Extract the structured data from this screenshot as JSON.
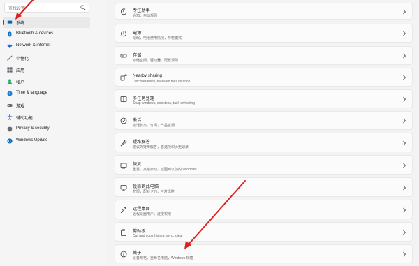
{
  "sidebar": {
    "search_placeholder": "查找设置",
    "items": [
      {
        "label": "系统",
        "icon": "laptop-icon",
        "color": "#0067c0"
      },
      {
        "label": "Bluetooth & devices",
        "icon": "bluetooth-icon",
        "color": "#0067c0"
      },
      {
        "label": "Network & internet",
        "icon": "wifi-icon",
        "color": "#2a6ec6"
      },
      {
        "label": "个性化",
        "icon": "brush-icon",
        "color": "#b56c2c"
      },
      {
        "label": "应用",
        "icon": "apps-icon",
        "color": "#5d6670"
      },
      {
        "label": "帐户",
        "icon": "account-icon",
        "color": "#2fa56f"
      },
      {
        "label": "Time & language",
        "icon": "globe-clock-icon",
        "color": "#1f7fd1"
      },
      {
        "label": "游戏",
        "icon": "gamepad-icon",
        "color": "#6b6b6b"
      },
      {
        "label": "辅助功能",
        "icon": "accessibility-icon",
        "color": "#2b66c4"
      },
      {
        "label": "Privacy & security",
        "icon": "shield-icon",
        "color": "#6b6b6b"
      },
      {
        "label": "Windows Update",
        "icon": "update-icon",
        "color": "#0067c0"
      }
    ]
  },
  "cards": [
    {
      "title": "专注助手",
      "subtitle": "通知，自动规则",
      "icon": "moon-icon"
    },
    {
      "title": "电源",
      "subtitle": "睡眠，电池使用情况，节电模式",
      "icon": "power-icon"
    },
    {
      "title": "存储",
      "subtitle": "存储空间，驱动器，配置规则",
      "icon": "storage-icon"
    },
    {
      "title": "Nearby sharing",
      "subtitle": "Discoverability, received files location",
      "icon": "share-icon"
    },
    {
      "title": "多任务处理",
      "subtitle": "Snap windows, desktops, task switching",
      "icon": "multitask-icon"
    },
    {
      "title": "激活",
      "subtitle": "激活状态，订阅，产品密钥",
      "icon": "check-circle-icon"
    },
    {
      "title": "疑难解答",
      "subtitle": "建议的疑难解答，首选项和历史记录",
      "icon": "wrench-icon"
    },
    {
      "title": "恢复",
      "subtitle": "重置，高级启动，返回到以前的 Windows",
      "icon": "recovery-icon"
    },
    {
      "title": "投影到此电脑",
      "subtitle": "权限，配对 PIN，可发现性",
      "icon": "projector-icon"
    },
    {
      "title": "远程桌面",
      "subtitle": "远程桌面用户，连接权限",
      "icon": "remote-icon"
    },
    {
      "title": "剪贴板",
      "subtitle": "Cut and copy history, sync, clear",
      "icon": "clipboard-icon"
    },
    {
      "title": "关于",
      "subtitle": "设备规格，重命名电脑，Windows 规格",
      "icon": "info-icon"
    }
  ],
  "colors": {
    "accent": "#0067c0",
    "annotation": "#e02020"
  }
}
